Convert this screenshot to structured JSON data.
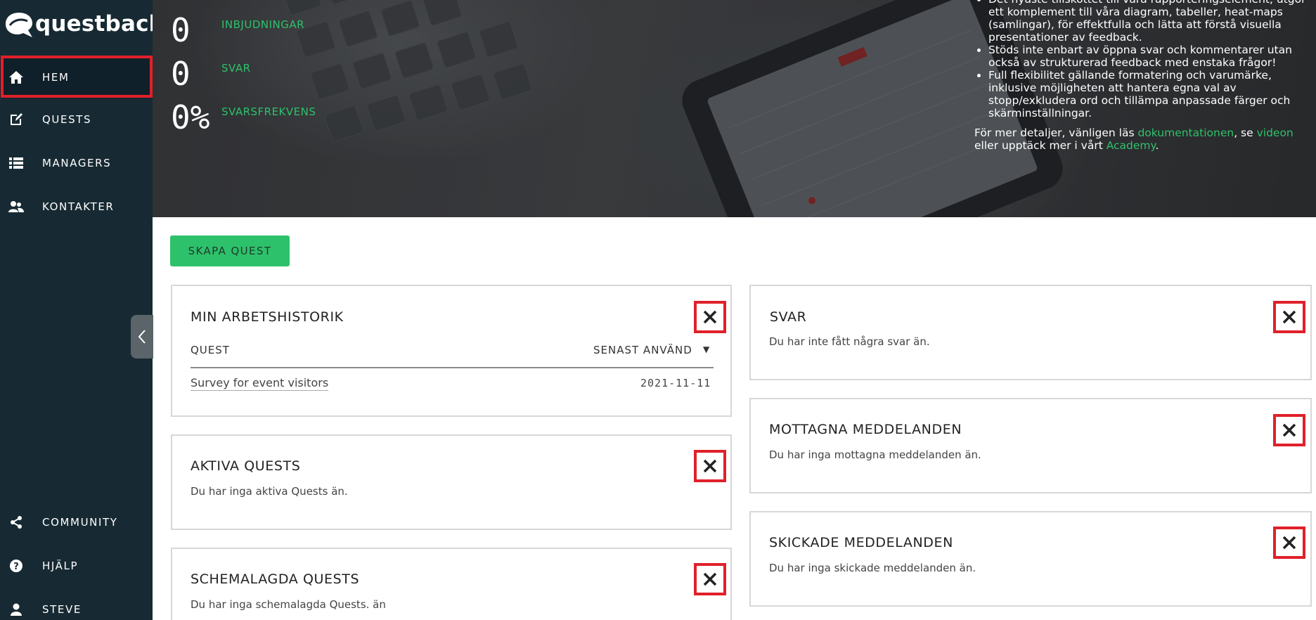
{
  "sidebar": {
    "logo_text": "questback",
    "nav": [
      {
        "label": "HEM",
        "icon": "home-icon"
      },
      {
        "label": "QUESTS",
        "icon": "edit-icon"
      },
      {
        "label": "MANAGERS",
        "icon": "list-icon"
      },
      {
        "label": "KONTAKTER",
        "icon": "contacts-icon"
      }
    ],
    "bottom_nav": [
      {
        "label": "COMMUNITY",
        "icon": "share-icon"
      },
      {
        "label": "HJÄLP",
        "icon": "help-icon"
      },
      {
        "label": "STEVE",
        "icon": "user-icon"
      }
    ]
  },
  "hero": {
    "stats": [
      {
        "value": "0",
        "label": "INBJUDNINGAR"
      },
      {
        "value": "0",
        "label": "SVAR"
      },
      {
        "value": "0%",
        "label": "SVARSFREKVENS"
      }
    ],
    "bullets": [
      "Det nyaste tillskottet till våra rapporteringselement, utgör ett komplement till våra diagram, tabeller, heat-maps (samlingar), för effektfulla och lätta att förstå visuella presentationer av feedback.",
      "Stöds inte enbart av öppna svar och kommentarer utan också av strukturerad feedback med enstaka frågor!",
      "Full flexibilitet gällande formatering och varumärke, inklusive möjligheten att hantera egna val av stopp/exkludera ord och tillämpa anpassade färger och skärminställningar."
    ],
    "details_prefix": "För mer detaljer, vänligen läs ",
    "details_link1": "dokumentationen",
    "details_mid": ", se ",
    "details_link2": "videon",
    "details_mid2": " eller upptäck mer i vårt ",
    "details_link3": "Academy",
    "details_suffix": "."
  },
  "create_button": "SKAPA QUEST",
  "cards": {
    "history": {
      "title": "MIN ARBETSHISTORIK",
      "col_quest": "QUEST",
      "col_last_used": "SENAST ANVÄND",
      "sort_icon": "▼",
      "rows": [
        {
          "name": "Survey for event visitors",
          "date": "2021-11-11"
        }
      ]
    },
    "active": {
      "title": "AKTIVA QUESTS",
      "text": "Du har inga aktiva Quests än."
    },
    "scheduled": {
      "title": "SCHEMALAGDA QUESTS",
      "text": "Du har inga schemalagda Quests. än"
    },
    "answers": {
      "title": "SVAR",
      "text": "Du har inte fått några svar än."
    },
    "received": {
      "title": "MOTTAGNA MEDDELANDEN",
      "text": "Du har inga mottagna meddelanden än."
    },
    "sent": {
      "title": "SKICKADE MEDDELANDEN",
      "text": "Du har inga skickade meddelanden än."
    }
  },
  "colors": {
    "sidebar_bg": "#172a33",
    "accent_green": "#2ec16b",
    "highlight_red": "#e0202a"
  }
}
